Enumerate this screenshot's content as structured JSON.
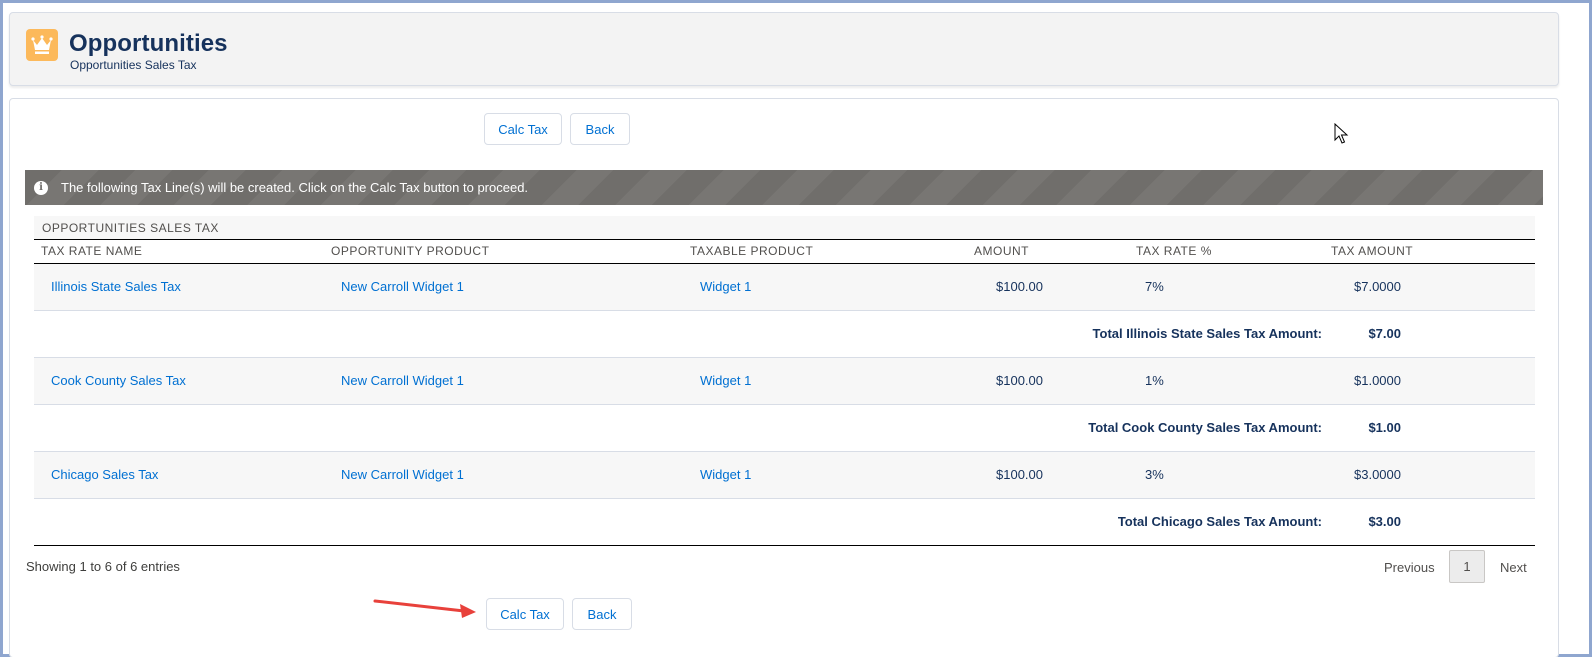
{
  "header": {
    "title": "Opportunities",
    "subtitle": "Opportunities Sales Tax",
    "icon": "crown-icon"
  },
  "toolbar": {
    "calc_tax_label": "Calc Tax",
    "back_label": "Back"
  },
  "notice": {
    "text": "The following Tax Line(s) will be created. Click on the Calc Tax button to proceed.",
    "icon": "info-icon"
  },
  "table": {
    "caption": "OPPORTUNITIES SALES TAX",
    "columns": [
      "TAX RATE NAME",
      "OPPORTUNITY PRODUCT",
      "TAXABLE PRODUCT",
      "AMOUNT",
      "TAX RATE %",
      "TAX AMOUNT"
    ],
    "rows": [
      {
        "name": "Illinois State Sales Tax",
        "product": "New Carroll Widget 1",
        "taxable": "Widget 1",
        "amount": "$100.00",
        "rate": "7%",
        "tax": "$7.0000",
        "total_label": "Total Illinois State Sales Tax Amount:",
        "total_value": "$7.00"
      },
      {
        "name": "Cook County Sales Tax",
        "product": "New Carroll Widget 1",
        "taxable": "Widget 1",
        "amount": "$100.00",
        "rate": "1%",
        "tax": "$1.0000",
        "total_label": "Total Cook County Sales Tax Amount:",
        "total_value": "$1.00"
      },
      {
        "name": "Chicago Sales Tax",
        "product": "New Carroll Widget 1",
        "taxable": "Widget 1",
        "amount": "$100.00",
        "rate": "3%",
        "tax": "$3.0000",
        "total_label": "Total Chicago Sales Tax Amount:",
        "total_value": "$3.00"
      }
    ]
  },
  "footer": {
    "entries_text": "Showing 1 to 6 of 6 entries",
    "previous_label": "Previous",
    "page_number": "1",
    "next_label": "Next"
  },
  "colors": {
    "link": "#0070d2",
    "header_icon_bg": "#fcb95b",
    "notice_bg": "#706e6b",
    "annotation_arrow": "#e8413b"
  }
}
